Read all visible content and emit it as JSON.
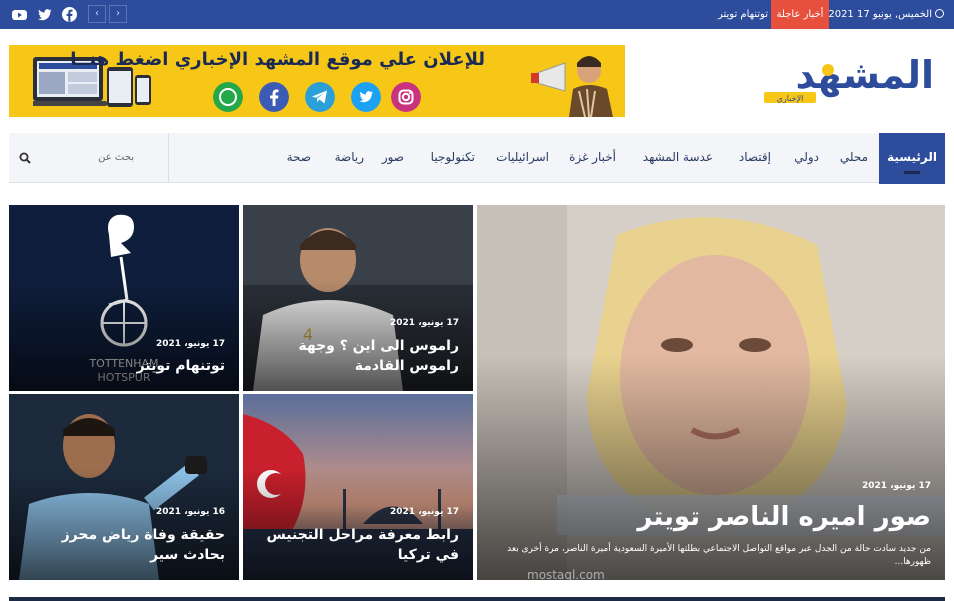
{
  "topbar": {
    "date": "الخميس, يونيو 17 2021",
    "breaking_label": "أخبار عاجلة",
    "ticker_text": "توتنهام تويتر",
    "prev_arrow": "‹",
    "next_arrow": "›",
    "social": [
      "youtube-icon",
      "twitter-icon",
      "facebook-icon"
    ]
  },
  "header": {
    "logo_text": "المشهد",
    "logo_subtext": "الإخباري",
    "banner_text": "للإعلان علي موقع المشهد الإخباري  اضغط هنــا",
    "banner_icons": [
      "instagram-icon",
      "twitter-icon",
      "telegram-icon",
      "facebook-icon",
      "whatsapp-icon"
    ]
  },
  "nav": {
    "home": "الرئيسية",
    "items": [
      "محلي",
      "دولي",
      "إقتصاد",
      "عدسة المشهد",
      "أخبار غزة",
      "اسرائيليات",
      "تكنولوجيا",
      "صور",
      "رياضة",
      "صحة"
    ],
    "search_placeholder": "بحث عن"
  },
  "articles": {
    "main": {
      "date": "17 يونيو، 2021",
      "title": "صور اميره الناصر تويتر",
      "excerpt": "من جديد سادت حالة من الجدل عبر مواقع التواصل الاجتماعي بطلتها الأميرة السعودية أميرة الناصر، مرة أخرى بعد ظهورها...",
      "watermark": "mostaql.com"
    },
    "ramos": {
      "date": "17 يونيو، 2021",
      "title": "راموس الى اين ؟ وجهة راموس القادمة"
    },
    "spurs": {
      "date": "17 يونيو، 2021",
      "title": "توتنهام تويتر"
    },
    "turkey": {
      "date": "17 يونيو، 2021",
      "title": "رابط معرفة مراحل التجنيس في تركيا"
    },
    "mahrez": {
      "date": "16 يونيو، 2021",
      "title": "حقيقة وفاة رياض محرز بحادث سير"
    }
  },
  "colors": {
    "brand_blue": "#2d4c9c",
    "breaking_red": "#e8503e",
    "banner_yellow": "#f6c716"
  }
}
